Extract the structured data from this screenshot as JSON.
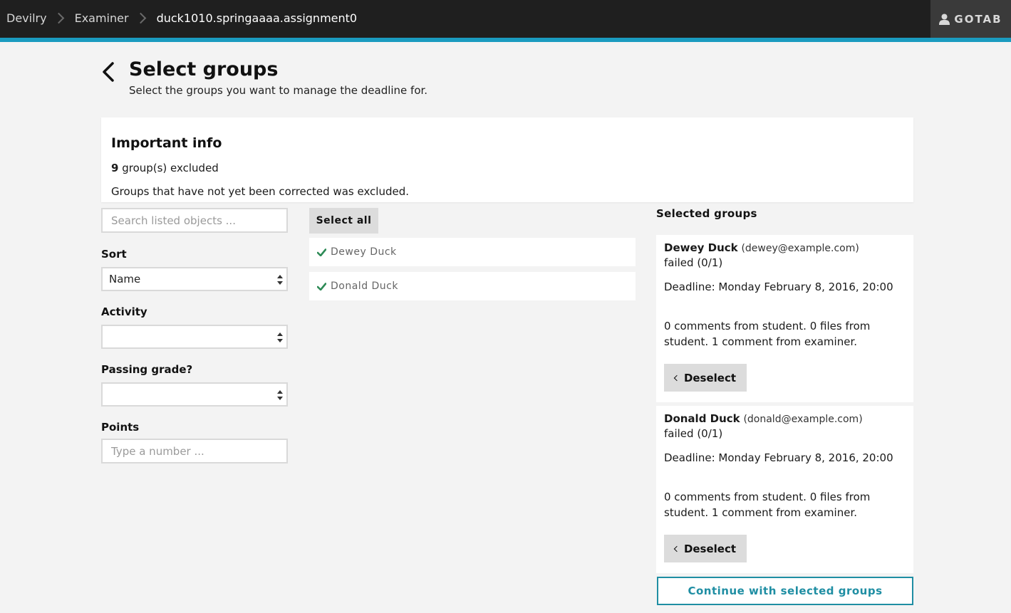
{
  "breadcrumb": {
    "items": [
      "Devilry",
      "Examiner",
      "duck1010.springaaaa.assignment0"
    ]
  },
  "user": {
    "label": "GOTAB"
  },
  "header": {
    "title": "Select groups",
    "subtitle": "Select the groups you want to manage the deadline for."
  },
  "info": {
    "title": "Important info",
    "excluded_count": "9",
    "excluded_label": " group(s) excluded",
    "note": "Groups that have not yet been corrected was excluded."
  },
  "filters": {
    "search_placeholder": "Search listed objects ...",
    "sort_label": "Sort",
    "sort_value": "Name",
    "activity_label": "Activity",
    "activity_value": "",
    "passing_label": "Passing grade?",
    "passing_value": "",
    "points_label": "Points",
    "points_placeholder": "Type a number ..."
  },
  "list": {
    "select_all": "Select all",
    "items": [
      {
        "name": "Dewey Duck"
      },
      {
        "name": "Donald Duck"
      }
    ]
  },
  "selected": {
    "title": "Selected groups",
    "groups": [
      {
        "name": "Dewey Duck",
        "email": "(dewey@example.com)",
        "status": "failed (0/1)",
        "deadline": "Deadline: Monday February 8, 2016, 20:00",
        "comments": "0 comments from student. 0 files from student. 1 comment from examiner.",
        "deselect": "Deselect"
      },
      {
        "name": "Donald Duck",
        "email": "(donald@example.com)",
        "status": "failed (0/1)",
        "deadline": "Deadline: Monday February 8, 2016, 20:00",
        "comments": "0 comments from student. 0 files from student. 1 comment from examiner.",
        "deselect": "Deselect"
      }
    ],
    "continue": "Continue with selected groups"
  },
  "colors": {
    "accent": "#1a9bbf",
    "topbar": "#1f1f1f",
    "check": "#2e8b57"
  },
  "icons": {
    "back": "chevron-left-icon",
    "user": "user-icon",
    "check": "checkmark-icon",
    "select_arrows": "sort-arrows-icon",
    "deselect": "chevron-left-small-icon"
  }
}
